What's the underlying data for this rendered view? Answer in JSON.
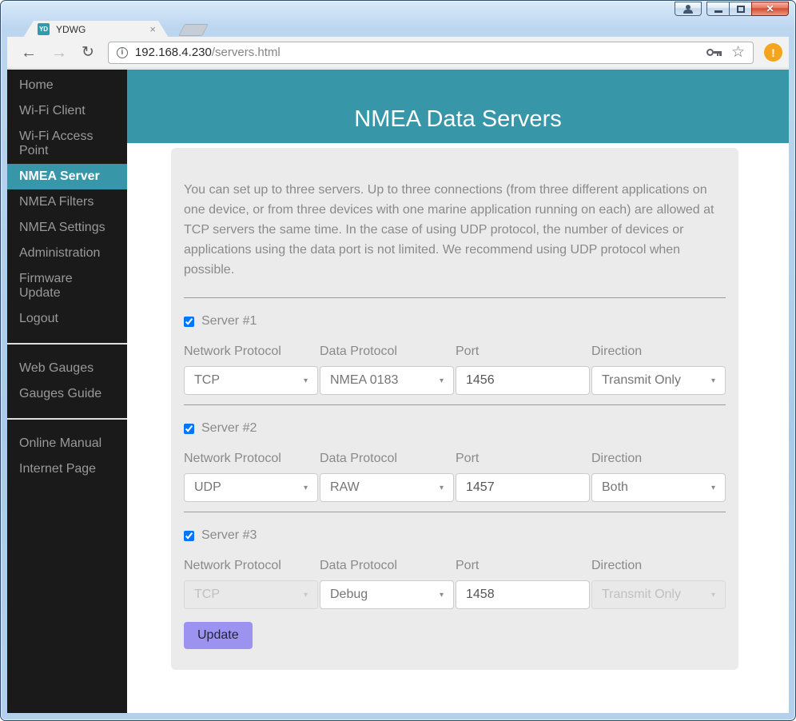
{
  "browser": {
    "tab": {
      "favicon": "YD",
      "title": "YDWG",
      "close_glyph": "×"
    },
    "toolbar": {
      "back_glyph": "←",
      "forward_glyph": "→",
      "reload_glyph": "↻",
      "info_glyph": "i",
      "url": {
        "host": "192.168.4.230",
        "path": "/servers.html"
      },
      "star_glyph": "☆",
      "menu_alert_glyph": "!"
    },
    "window_controls": {
      "close_glyph": "✕"
    }
  },
  "sidebar": {
    "active_item": "NMEA Server",
    "groups": [
      {
        "items": [
          "Home",
          "Wi-Fi Client",
          "Wi-Fi Access Point",
          "NMEA Server",
          "NMEA Filters",
          "NMEA Settings",
          "Administration",
          "Firmware Update",
          "Logout"
        ]
      },
      {
        "items": [
          "Web Gauges",
          "Gauges Guide"
        ]
      },
      {
        "items": [
          "Online Manual",
          "Internet Page"
        ]
      }
    ]
  },
  "header": {
    "title": "NMEA Data Servers"
  },
  "panel": {
    "intro": "You can set up to three servers. Up to three connections (from three different applications on one device, or from three devices with one marine application running on each) are allowed at TCP servers the same time. In the case of using UDP protocol, the number of devices or applications using the data port is not limited. We recommend using UDP protocol when possible.",
    "field_labels": {
      "network": "Network Protocol",
      "data": "Data Protocol",
      "port": "Port",
      "direction": "Direction"
    },
    "servers": [
      {
        "label": "Server #1",
        "checked": true,
        "network": "TCP",
        "data": "NMEA 0183",
        "port": "1456",
        "direction": "Transmit Only",
        "network_disabled": false,
        "direction_disabled": false
      },
      {
        "label": "Server #2",
        "checked": true,
        "network": "UDP",
        "data": "RAW",
        "port": "1457",
        "direction": "Both",
        "network_disabled": false,
        "direction_disabled": false
      },
      {
        "label": "Server #3",
        "checked": true,
        "network": "TCP",
        "data": "Debug",
        "port": "1458",
        "direction": "Transmit Only",
        "network_disabled": true,
        "direction_disabled": true
      }
    ],
    "update_button": "Update"
  },
  "icons": {
    "caret": "▾"
  },
  "colors": {
    "accent_teal": "#3797a9",
    "sidebar_bg": "#1a1a1a",
    "panel_bg": "#ebebeb",
    "button_purple": "#9c92f0",
    "alert_orange": "#f3a51d"
  }
}
